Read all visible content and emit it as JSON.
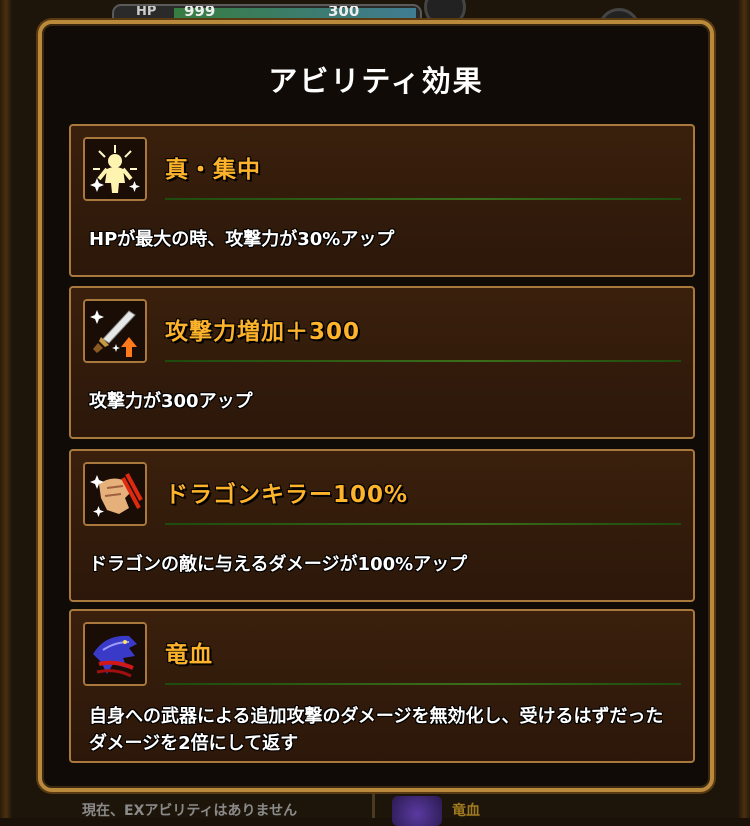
{
  "background": {
    "hp_label": "HP",
    "hp_value": "999",
    "attack_value": "300",
    "bottom_text": "現在、EXアビリティはありません",
    "bottom_right_label": "竜血"
  },
  "modal": {
    "title": "アビリティ効果",
    "abilities": [
      {
        "name": "真・集中",
        "description": "HPが最大の時、攻撃力が30%アップ",
        "icon": "shining-figure-icon"
      },
      {
        "name": "攻撃力増加＋300",
        "description": "攻撃力が300アップ",
        "icon": "sword-up-icon"
      },
      {
        "name": "ドラゴンキラー100%",
        "description": "ドラゴンの敵に与えるダメージが100%アップ",
        "icon": "dragon-slash-icon"
      },
      {
        "name": "竜血",
        "description": "自身への武器による追加攻撃のダメージを無効化し、受けるはずだったダメージを2倍にして返す",
        "icon": "dragon-blood-icon"
      }
    ]
  },
  "colors": {
    "ability_name": "#ffb32a",
    "card_border": "#a9783c",
    "separator": "#3a6e1a"
  }
}
